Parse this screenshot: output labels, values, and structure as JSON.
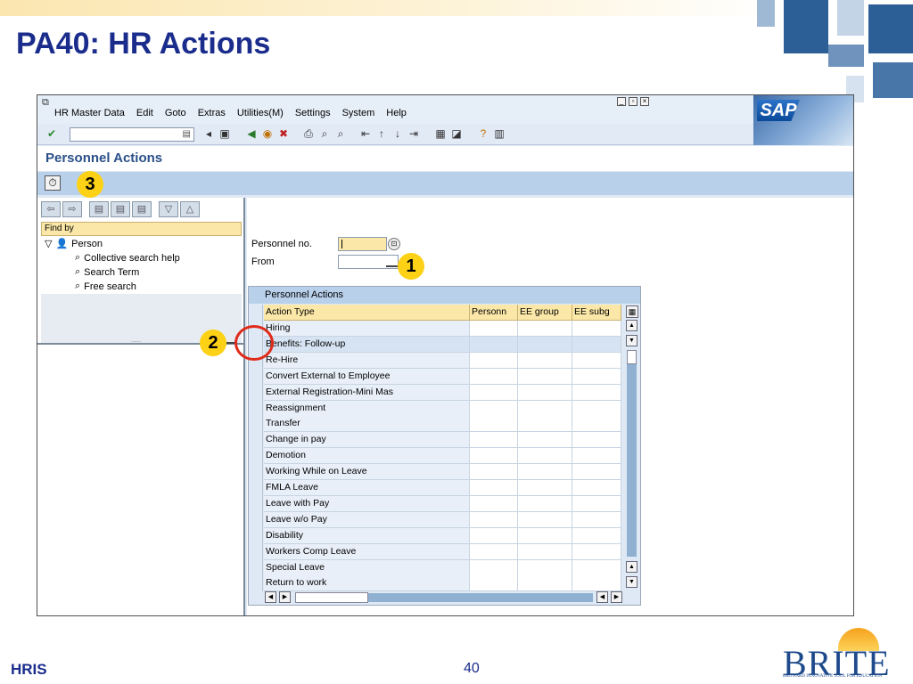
{
  "slide": {
    "title": "PA40: HR Actions",
    "footer_left": "HRIS",
    "page_number": "40",
    "logo_word": "BRITE",
    "logo_tagline": "BROWARD INNOVATIVE TOOL FOR EDUCATION"
  },
  "sap": {
    "menu": [
      "HR Master Data",
      "Edit",
      "Goto",
      "Extras",
      "Utilities(M)",
      "Settings",
      "System",
      "Help"
    ],
    "logo": "SAP",
    "screen_title": "Personnel Actions",
    "left_panel": {
      "find_by": "Find by",
      "tree": {
        "root": "Person",
        "children": [
          "Collective search help",
          "Search Term",
          "Free search"
        ]
      },
      "splitter_dots": "....."
    },
    "fields": {
      "personnel_no_label": "Personnel no.",
      "from_label": "From"
    },
    "grid": {
      "title": "Personnel Actions",
      "headers": [
        "Action Type",
        "Personn",
        "EE group",
        "EE subg"
      ],
      "rows": [
        "Hiring",
        "Benefits: Follow-up",
        "Re-Hire",
        "Convert External to Employee",
        "External Registration-Mini Mas",
        "Reassignment",
        "Transfer",
        "Change in pay",
        "Demotion",
        "Working While on Leave",
        "FMLA Leave",
        "Leave with Pay",
        "Leave w/o Pay",
        "Disability",
        "Workers Comp Leave",
        "Special Leave",
        "Return to work"
      ],
      "highlighted_row_index": 1
    }
  },
  "callouts": [
    "1",
    "2",
    "3"
  ],
  "colors": {
    "title_blue": "#1a2c8c",
    "callout_yellow": "#fcd116",
    "ring_red": "#e02a1a",
    "header_yellow": "#fbe8a8"
  }
}
